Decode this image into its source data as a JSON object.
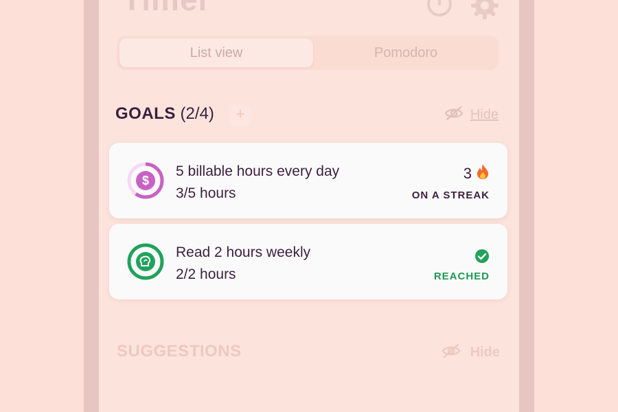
{
  "app": {
    "title": "Timer"
  },
  "tabs": [
    {
      "label": "List view",
      "active": true
    },
    {
      "label": "Pomodoro",
      "active": false
    }
  ],
  "goals": {
    "title": "GOALS",
    "count": "(2/4)",
    "add_label": "+",
    "hide_label": "Hide",
    "items": [
      {
        "title": "5 billable hours every day",
        "progress_text": "3/5 hours",
        "progress": 0.6,
        "icon": "dollar-icon",
        "color": "#c762c4",
        "streak_count": "3",
        "streak_icon": "fire-icon",
        "status_label": "ON A STREAK"
      },
      {
        "title": "Read 2 hours weekly",
        "progress_text": "2/2 hours",
        "progress": 1.0,
        "icon": "brain-icon",
        "color": "#21a25c",
        "status_icon": "check-icon",
        "status_label": "REACHED"
      }
    ]
  },
  "suggestions": {
    "title": "SUGGESTIONS",
    "hide_label": "Hide"
  },
  "colors": {
    "background": "#fde0d7",
    "text_dark": "#3b1f3f",
    "accent_purple": "#c762c4",
    "accent_green": "#21a25c"
  }
}
